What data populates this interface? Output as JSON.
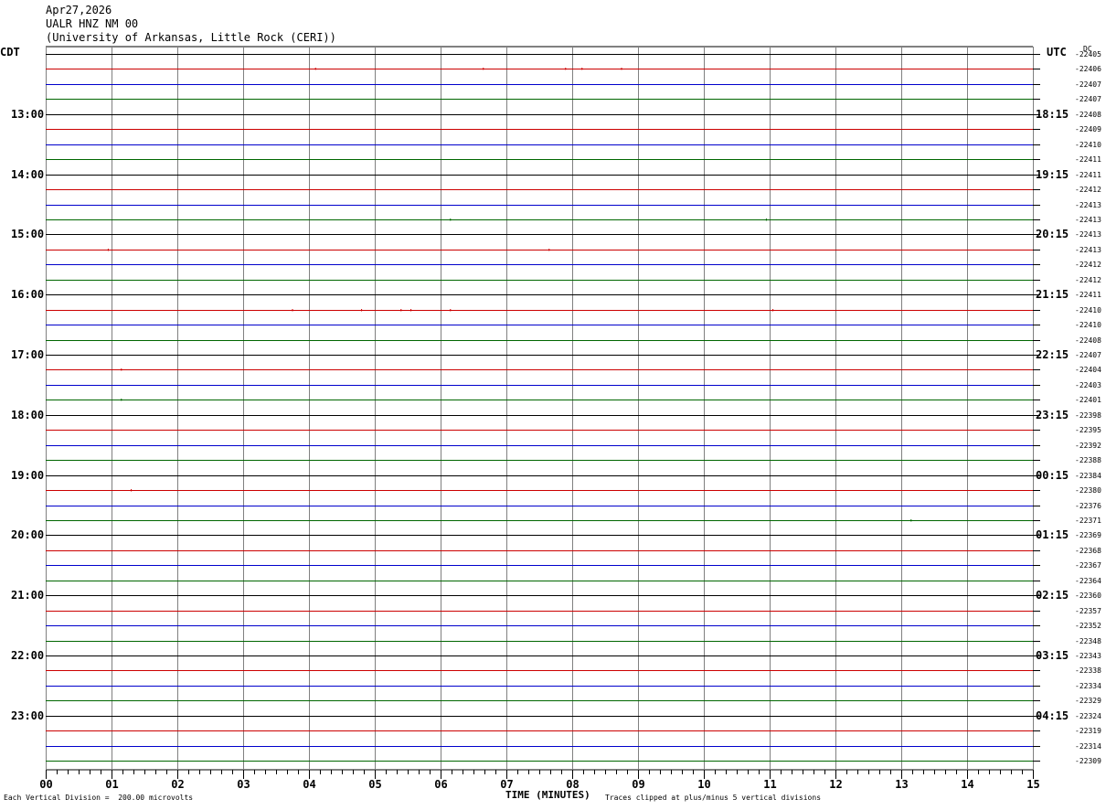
{
  "header": {
    "date": "Apr27,2026",
    "station": "UALR HNZ NM 00",
    "institution": "(University of Arkansas, Little Rock (CERI))"
  },
  "axes": {
    "left_tz": "CDT",
    "right_tz": "UTC",
    "dc_label": "DC",
    "x_title": "TIME (MINUTES)"
  },
  "footer": {
    "scale_note": "Each Vertical Division =  200.00 microvolts",
    "clip_note": "Traces clipped at plus/minus 5 vertical divisions"
  },
  "colors": {
    "black": "#000000",
    "red": "#cc0000",
    "blue": "#0000cc",
    "green": "#006600",
    "grid": "#808080"
  },
  "chart_data": {
    "type": "line",
    "title": "UALR HNZ NM 00",
    "x_label": "TIME (MINUTES)",
    "x_ticks": [
      "00",
      "01",
      "02",
      "03",
      "04",
      "05",
      "06",
      "07",
      "08",
      "09",
      "10",
      "11",
      "12",
      "13",
      "14",
      "15"
    ],
    "xlim": [
      0,
      15
    ],
    "left_hour_labels": [
      "13:00",
      "14:00",
      "15:00",
      "16:00",
      "17:00",
      "18:00",
      "19:00",
      "20:00",
      "21:00",
      "22:00",
      "23:00"
    ],
    "right_hour_labels": [
      "18:15",
      "19:15",
      "20:15",
      "21:15",
      "22:15",
      "23:15",
      "00:15",
      "01:15",
      "02:15",
      "03:15",
      "04:15"
    ],
    "dc_offsets": [
      "-22405",
      "-22406",
      "-22407",
      "-22407",
      "-22408",
      "-22409",
      "-22410",
      "-22411",
      "-22411",
      "-22412",
      "-22413",
      "-22413",
      "-22413",
      "-22413",
      "-22412",
      "-22412",
      "-22411",
      "-22410",
      "-22410",
      "-22408",
      "-22407",
      "-22404",
      "-22403",
      "-22401",
      "-22398",
      "-22395",
      "-22392",
      "-22388",
      "-22384",
      "-22380",
      "-22376",
      "-22371",
      "-22369",
      "-22368",
      "-22367",
      "-22364",
      "-22360",
      "-22357",
      "-22352",
      "-22348",
      "-22343",
      "-22338",
      "-22334",
      "-22329",
      "-22324",
      "-22319",
      "-22314",
      "-22309"
    ],
    "trace_color_cycle": [
      "black",
      "red",
      "blue",
      "green"
    ],
    "traces_count": 48,
    "blips": [
      {
        "trace": 1,
        "x": 4.1
      },
      {
        "trace": 1,
        "x": 6.65
      },
      {
        "trace": 1,
        "x": 7.9
      },
      {
        "trace": 1,
        "x": 8.15
      },
      {
        "trace": 1,
        "x": 8.75
      },
      {
        "trace": 11,
        "x": 6.15
      },
      {
        "trace": 11,
        "x": 10.95
      },
      {
        "trace": 13,
        "x": 0.95
      },
      {
        "trace": 13,
        "x": 7.65
      },
      {
        "trace": 17,
        "x": 3.75
      },
      {
        "trace": 17,
        "x": 4.8
      },
      {
        "trace": 17,
        "x": 5.4
      },
      {
        "trace": 17,
        "x": 5.55
      },
      {
        "trace": 17,
        "x": 6.15
      },
      {
        "trace": 17,
        "x": 11.05
      },
      {
        "trace": 21,
        "x": 1.15
      },
      {
        "trace": 23,
        "x": 1.15
      },
      {
        "trace": 29,
        "x": 1.3
      },
      {
        "trace": 31,
        "x": 13.15
      }
    ]
  }
}
